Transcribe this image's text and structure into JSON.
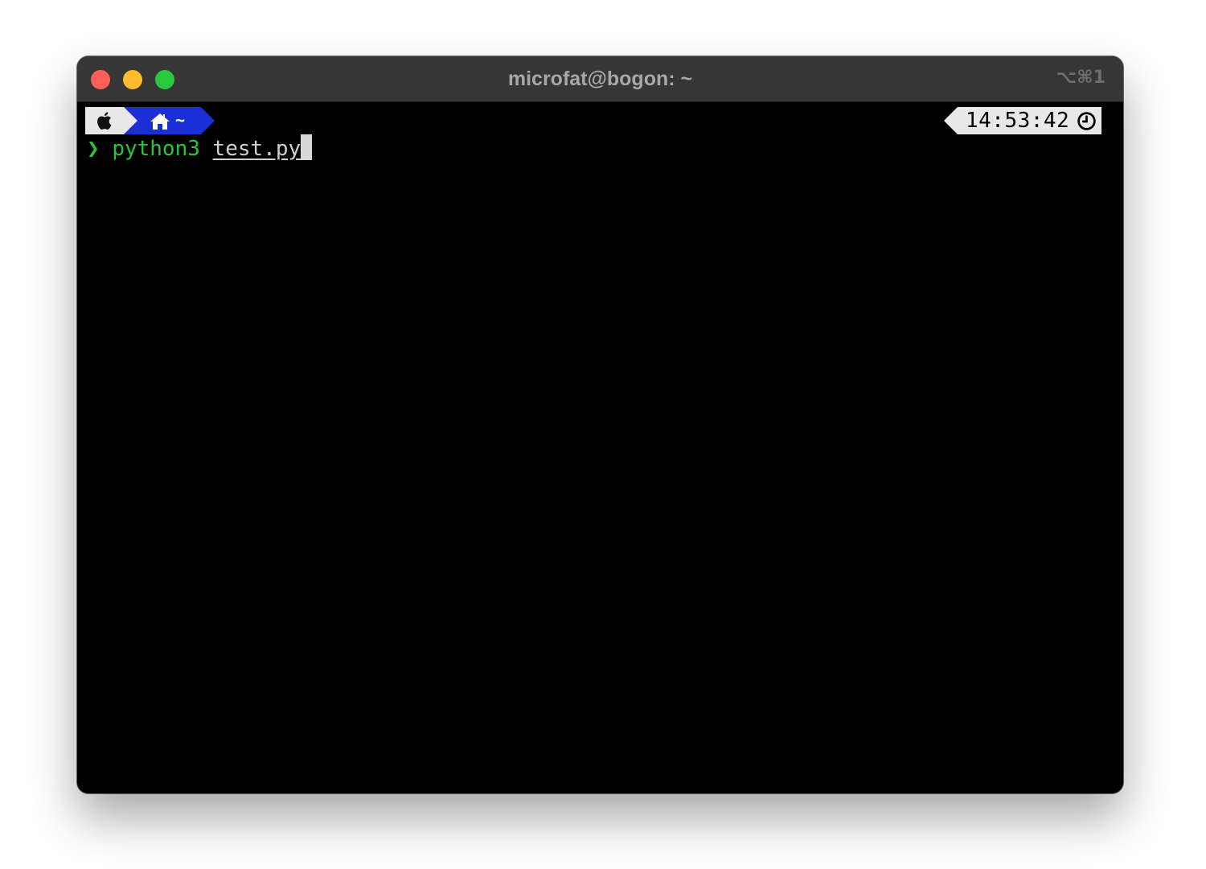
{
  "window": {
    "title": "microfat@bogon: ~",
    "shortcut": "⌥⌘1"
  },
  "prompt": {
    "os_icon": "apple-icon",
    "dir_icon": "home-icon",
    "dir": "~",
    "time": "14:53:42",
    "time_icon": "clock-icon",
    "prompt_char": "❯"
  },
  "command": {
    "program": "python3",
    "argument": "test.py"
  },
  "colors": {
    "close": "#fe5f57",
    "minimize": "#febc2e",
    "maximize": "#28c840",
    "dir_segment": "#1b2fd6",
    "os_segment": "#e8e8e8",
    "command": "#2ac43c",
    "background": "#000000"
  }
}
